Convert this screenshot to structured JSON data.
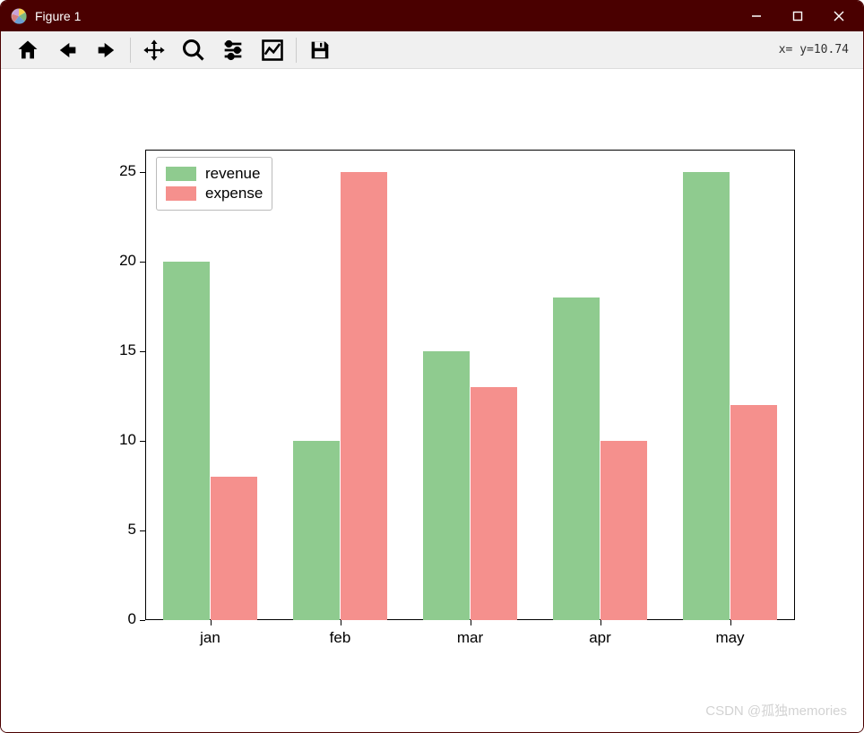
{
  "window": {
    "title": "Figure 1"
  },
  "toolbar": {
    "coord_readout": "x=  y=10.74"
  },
  "legend": {
    "entries": [
      {
        "label": "revenue",
        "color": "#8fcb8f"
      },
      {
        "label": "expense",
        "color": "#f5908d"
      }
    ]
  },
  "axes": {
    "yticks": [
      "0",
      "5",
      "10",
      "15",
      "20",
      "25"
    ],
    "xticks": [
      "jan",
      "feb",
      "mar",
      "apr",
      "may"
    ]
  },
  "watermark": "CSDN @孤独memories",
  "chart_data": {
    "type": "bar",
    "categories": [
      "jan",
      "feb",
      "mar",
      "apr",
      "may"
    ],
    "series": [
      {
        "name": "revenue",
        "values": [
          20,
          10,
          15,
          18,
          25
        ],
        "color": "#8fcb8f"
      },
      {
        "name": "expense",
        "values": [
          8,
          25,
          13,
          10,
          12
        ],
        "color": "#f5908d"
      }
    ],
    "title": "",
    "xlabel": "",
    "ylabel": "",
    "ylim": [
      0,
      26.25
    ]
  }
}
